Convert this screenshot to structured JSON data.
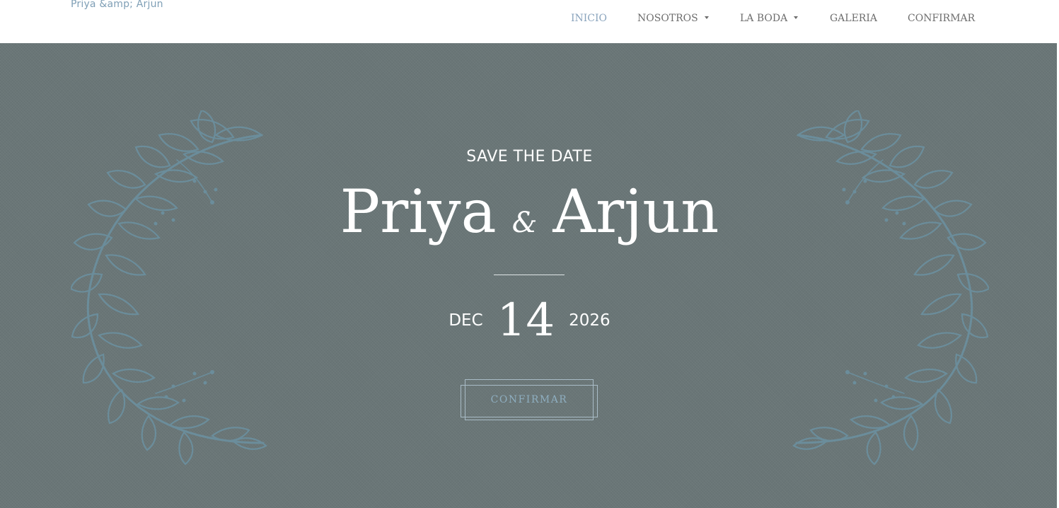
{
  "brand": {
    "text": "Priya &amp; Arjun"
  },
  "nav": {
    "items": [
      {
        "label": "INICIO",
        "active": true,
        "dropdown": false
      },
      {
        "label": "NOSOTROS",
        "active": false,
        "dropdown": true
      },
      {
        "label": "LA BODA",
        "active": false,
        "dropdown": true
      },
      {
        "label": "GALERIA",
        "active": false,
        "dropdown": false
      },
      {
        "label": "CONFIRMAR",
        "active": false,
        "dropdown": false
      }
    ]
  },
  "hero": {
    "eyebrow": "SAVE THE DATE",
    "name1": "Priya",
    "ampersand": "&",
    "name2": "Arjun",
    "date": {
      "month": "DEC",
      "day": "14",
      "year": "2026"
    },
    "cta_label": "CONFIRMAR"
  },
  "colors": {
    "hero_background": "#6a7677",
    "accent": "#8aa4bd",
    "wreath": "#6b8d9b",
    "text_light": "#ffffff"
  }
}
